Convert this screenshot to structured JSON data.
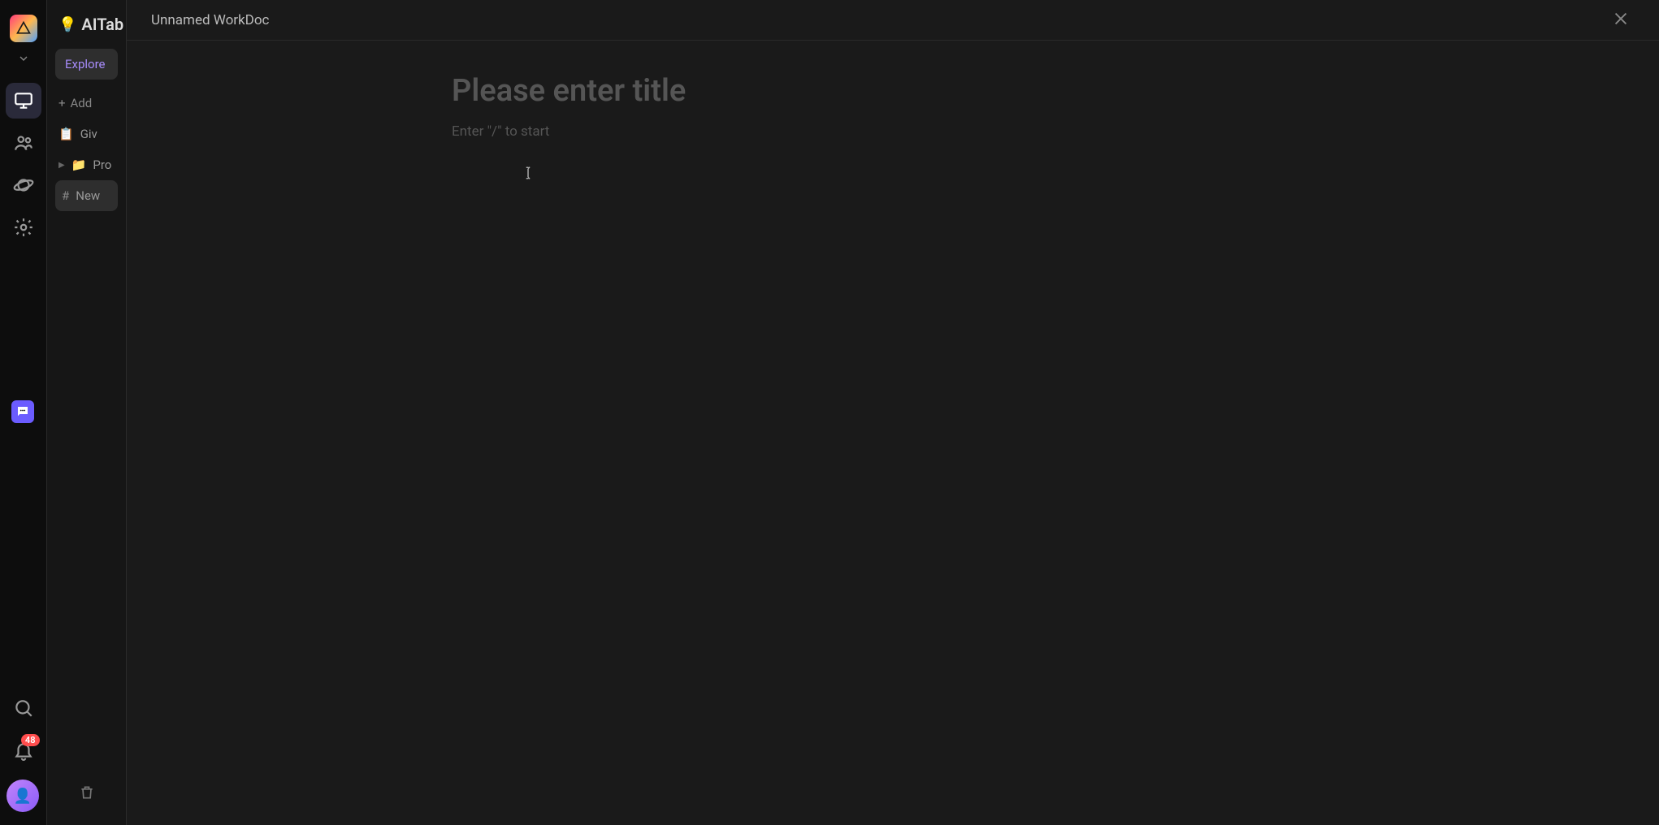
{
  "brand": {
    "emoji": "💡",
    "name": "AITab"
  },
  "rail": {
    "notification_count": "48"
  },
  "side": {
    "explore_label": "Explore",
    "add_label": "Add",
    "items": [
      {
        "icon": "📋",
        "label": "Giv"
      },
      {
        "icon": "📁",
        "label": "Pro"
      },
      {
        "icon": "#",
        "label": "New"
      }
    ]
  },
  "titlebar": {
    "title": "Unnamed WorkDoc"
  },
  "editor": {
    "title_placeholder": "Please enter title",
    "body_placeholder": "Enter \"/\" to start"
  }
}
